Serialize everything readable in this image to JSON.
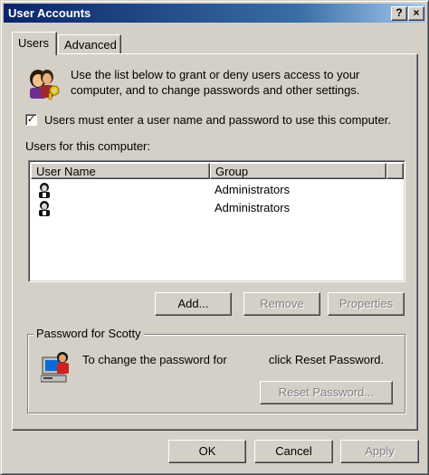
{
  "window": {
    "title": "User Accounts",
    "help_glyph": "?",
    "close_glyph": "×"
  },
  "tabs": [
    {
      "label": "Users",
      "selected": true
    },
    {
      "label": "Advanced",
      "selected": false
    }
  ],
  "intro": {
    "icon": "users-key-icon",
    "text": "Use the list below to grant or deny users access to your computer, and to change passwords and other settings."
  },
  "require_login": {
    "checked": true,
    "check_glyph": "✓",
    "label": "Users must enter a user name and password to use this computer."
  },
  "users_list": {
    "label": "Users for this computer:",
    "columns": [
      "User Name",
      "Group",
      ""
    ],
    "rows": [
      {
        "user_name": "",
        "group": "Administrators",
        "icon": "user-icon"
      },
      {
        "user_name": "",
        "group": "Administrators",
        "icon": "user-icon"
      }
    ]
  },
  "list_buttons": {
    "add": {
      "label": "Add...",
      "enabled": true
    },
    "remove": {
      "label": "Remove",
      "enabled": false
    },
    "properties": {
      "label": "Properties",
      "enabled": false
    }
  },
  "password_group": {
    "title": "Password for Scotty",
    "icon": "computer-user-icon",
    "text_part1": "To change the password for",
    "text_part2": "click Reset Password.",
    "reset_button": {
      "label": "Reset Password...",
      "enabled": false
    }
  },
  "footer_buttons": {
    "ok": {
      "label": "OK",
      "enabled": true
    },
    "cancel": {
      "label": "Cancel",
      "enabled": true
    },
    "apply": {
      "label": "Apply",
      "enabled": false
    }
  },
  "colors": {
    "title_active": "#0a246a",
    "face": "#d4d0c8",
    "disabled_text": "#808080"
  }
}
